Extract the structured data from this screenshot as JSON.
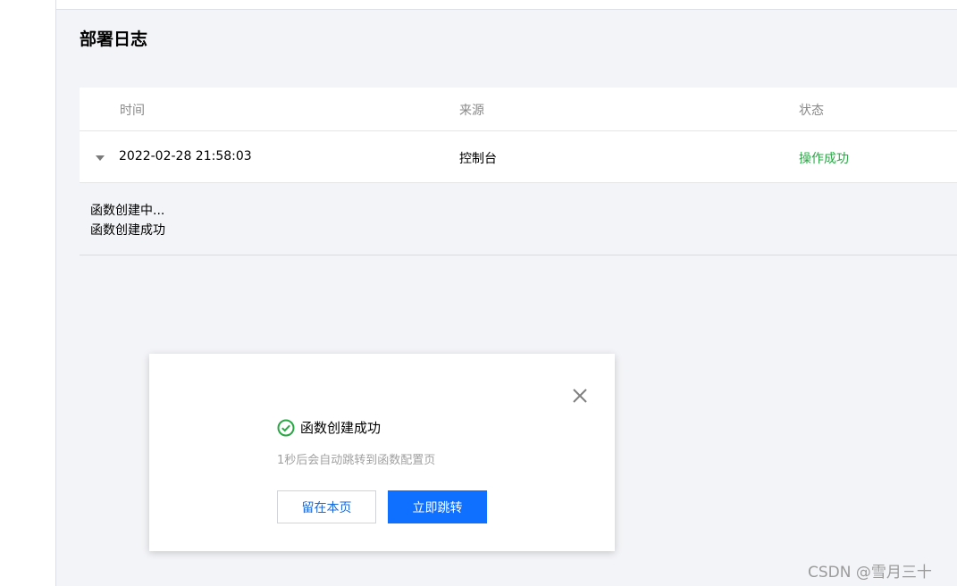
{
  "page": {
    "title": "部署日志"
  },
  "table": {
    "columns": [
      "时间",
      "来源",
      "状态"
    ],
    "rows": [
      {
        "time": "2022-02-28 21:58:03",
        "source": "控制台",
        "status": "操作成功"
      }
    ],
    "detail_lines": [
      "函数创建中...",
      "函数创建成功"
    ]
  },
  "dialog": {
    "title": "函数创建成功",
    "subtitle": "1秒后会自动跳转到函数配置页",
    "stay_label": "留在本页",
    "go_label": "立即跳转"
  },
  "watermark": "CSDN @雪月三十",
  "colors": {
    "success": "#29a745",
    "primary": "#0f6fff",
    "link": "#1a68d8",
    "background": "#f3f4f7"
  }
}
